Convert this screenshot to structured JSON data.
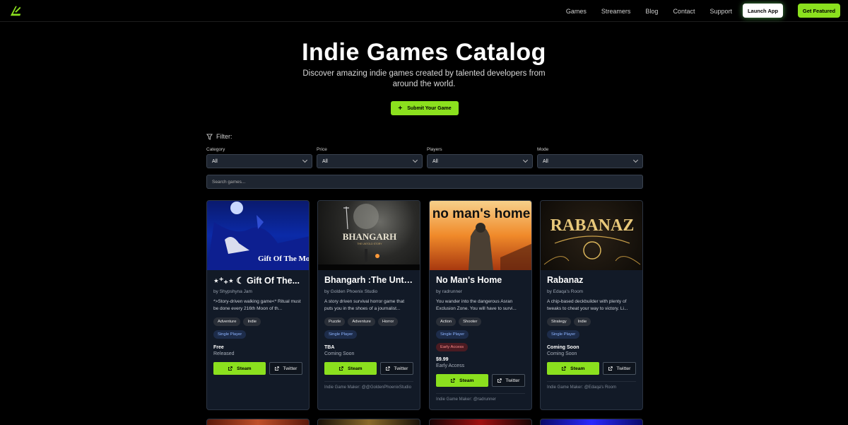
{
  "nav": {
    "links": [
      "Games",
      "Streamers",
      "Blog",
      "Contact",
      "Support"
    ],
    "launch_label": "Launch App",
    "featured_label": "Get Featured"
  },
  "hero": {
    "title": "Indie Games Catalog",
    "subtitle": "Discover amazing indie games created by talented developers from around the world.",
    "submit_label": "Submit Your Game"
  },
  "filters": {
    "heading": "Filter:",
    "groups": [
      {
        "label": "Category",
        "value": "All"
      },
      {
        "label": "Price",
        "value": "All"
      },
      {
        "label": "Players",
        "value": "All"
      },
      {
        "label": "Mode",
        "value": "All"
      }
    ],
    "search_placeholder": "Search games..."
  },
  "cards": [
    {
      "title": "⋆⁺₊⋆ ☾ Gift Of The...",
      "image_text": "Gift Of The Moon",
      "developer": "by Shypshyna Jam",
      "description": "*>Story-driven walking game<* Ritual must be done every 216th Moon of th...",
      "tags": [
        "Adventure",
        "Indie"
      ],
      "mode": "Single Player",
      "price": "Free",
      "status": "Released",
      "steam_label": "Steam",
      "twitter_label": "Twitter",
      "maker": ""
    },
    {
      "title": "Bhangarh :The Untol...",
      "image_text": "BHANGARH",
      "image_subtext": "THE UNTOLD STORY",
      "developer": "by Golden Phoenix Studio",
      "description": "A story driven survival horror game that puts you in the shoes of a journalist...",
      "tags": [
        "Puzzle",
        "Adventure",
        "Horror"
      ],
      "mode": "Single Player",
      "price": "TBA",
      "status": "Coming Soon",
      "steam_label": "Steam",
      "twitter_label": "Twitter",
      "maker": "Indie Game Maker: @@GoldenPhoenixStudio"
    },
    {
      "title": "No Man's Home",
      "image_text": "no man's home",
      "developer": "by radrunner",
      "description": "You wander into the dangerous Asran Exclusion Zone. You will have to survi...",
      "tags": [
        "Action",
        "Shooter"
      ],
      "mode": "Single Player",
      "early_access": "Early Access",
      "price": "$9.99",
      "status": "Early Access",
      "steam_label": "Steam",
      "twitter_label": "Twitter",
      "maker": "Indie Game Maker: @radrunner"
    },
    {
      "title": "Rabanaz",
      "image_text": "RABANAZ",
      "developer": "by Edaqa's Room",
      "description": "A chip-based deckbuilder with plenty of tweaks to cheat your way to victory. Li...",
      "tags": [
        "Strategy",
        "Indie"
      ],
      "mode": "Single Player",
      "price": "Coming Soon",
      "status": "Coming Soon",
      "steam_label": "Steam",
      "twitter_label": "Twitter",
      "maker": "Indie Game Maker: @Edaqa's Room"
    }
  ],
  "colors": {
    "accent": "#8be01e",
    "card_bg": "#121a27",
    "mode_badge": "#8db4ff",
    "early_access_badge": "#ff8a8a"
  }
}
